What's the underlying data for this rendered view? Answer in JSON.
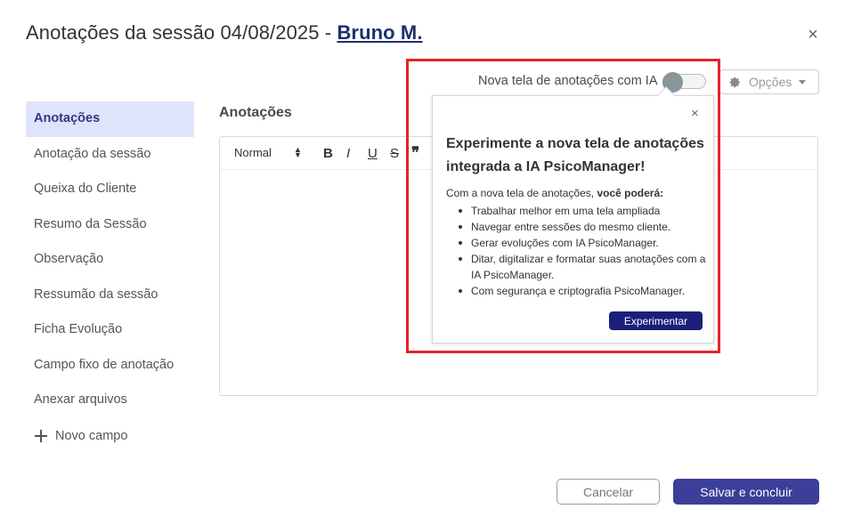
{
  "header": {
    "title_prefix": "Anotações da sessão 04/08/2025 - ",
    "client_name": "Bruno M.",
    "close_symbol": "×"
  },
  "sidebar": {
    "items": [
      {
        "label": "Anotações",
        "active": true
      },
      {
        "label": "Anotação da sessão"
      },
      {
        "label": "Queixa do Cliente"
      },
      {
        "label": "Resumo da Sessão"
      },
      {
        "label": "Observação"
      },
      {
        "label": "Ressumão da sessão"
      },
      {
        "label": "Ficha Evolução"
      },
      {
        "label": "Campo fixo de anotação"
      },
      {
        "label": "Anexar arquivos"
      }
    ],
    "new_field": "Novo campo"
  },
  "main": {
    "section_title": "Anotações",
    "editor": {
      "format_select": "Normal",
      "toolbar": {
        "bold": "B",
        "italic": "I",
        "underline": "U",
        "strike": "S",
        "quote": "❞"
      }
    }
  },
  "toggle": {
    "label": "Nova tela de anotações com IA",
    "on": false
  },
  "options": {
    "label": "Opções"
  },
  "popover": {
    "close": "×",
    "title": "Experimente a nova tela de anotações integrada a IA PsicoManager!",
    "intro_prefix": "Com a nova tela de anotações, ",
    "intro_bold": "você poderá:",
    "bullets": [
      "Trabalhar melhor em uma tela ampliada",
      "Navegar entre sessões do mesmo cliente.",
      "Gerar evoluções com IA PsicoManager.",
      "Ditar, digitalizar e formatar suas anotações com a IA PsicoManager.",
      "Com segurança e criptografia PsicoManager."
    ],
    "button": "Experimentar"
  },
  "footer": {
    "cancel": "Cancelar",
    "save": "Salvar e concluir"
  },
  "colors": {
    "accent": "#3b3f9a",
    "highlight_border": "#e3242b",
    "active_bg": "#dfe3fb",
    "client_link": "#1d2f6f"
  }
}
